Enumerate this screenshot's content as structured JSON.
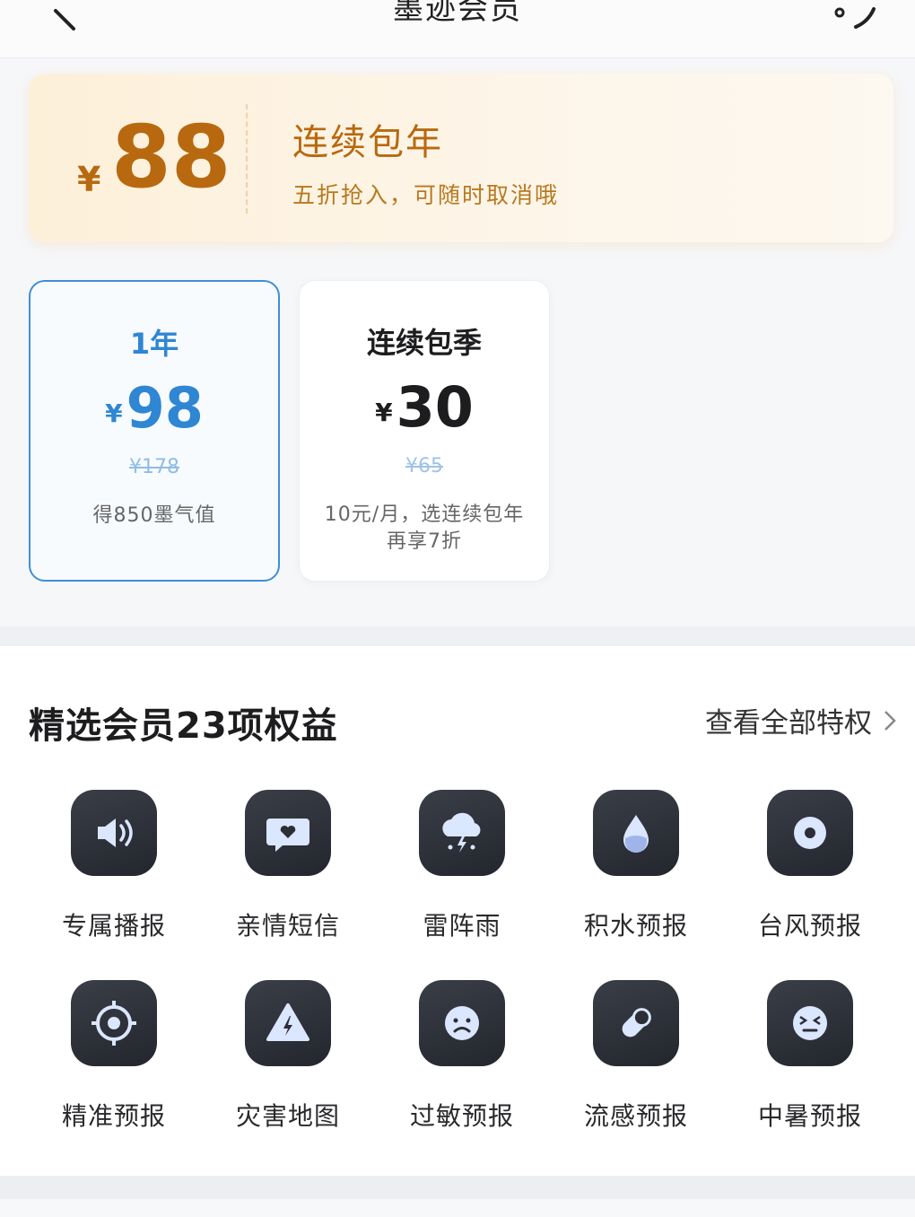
{
  "header": {
    "title": "墨迹会员"
  },
  "hero": {
    "currency": "¥",
    "price": "88",
    "title": "连续包年",
    "subtitle": "五折抢入，可随时取消哦"
  },
  "plans": [
    {
      "name": "1年",
      "currency": "¥",
      "price": "98",
      "original": "¥178",
      "desc": "得850墨气值",
      "selected": true
    },
    {
      "name": "连续包季",
      "currency": "¥",
      "price": "30",
      "original": "¥65",
      "desc": "10元/月，选连续包年再享7折",
      "selected": false
    }
  ],
  "benefits": {
    "title": "精选会员23项权益",
    "link": "查看全部特权",
    "items": [
      {
        "label": "专属播报",
        "icon": "speaker-icon"
      },
      {
        "label": "亲情短信",
        "icon": "heart-message-icon"
      },
      {
        "label": "雷阵雨",
        "icon": "thunderstorm-icon"
      },
      {
        "label": "积水预报",
        "icon": "water-drop-icon"
      },
      {
        "label": "台风预报",
        "icon": "typhoon-icon"
      },
      {
        "label": "精准预报",
        "icon": "target-icon"
      },
      {
        "label": "灾害地图",
        "icon": "warning-icon"
      },
      {
        "label": "过敏预报",
        "icon": "sad-face-icon"
      },
      {
        "label": "流感预报",
        "icon": "pill-icon"
      },
      {
        "label": "中暑预报",
        "icon": "dizzy-face-icon"
      }
    ]
  },
  "colors": {
    "accent": "#2f86d3",
    "gold": "#b8690f",
    "tile": "#2b2e35"
  }
}
